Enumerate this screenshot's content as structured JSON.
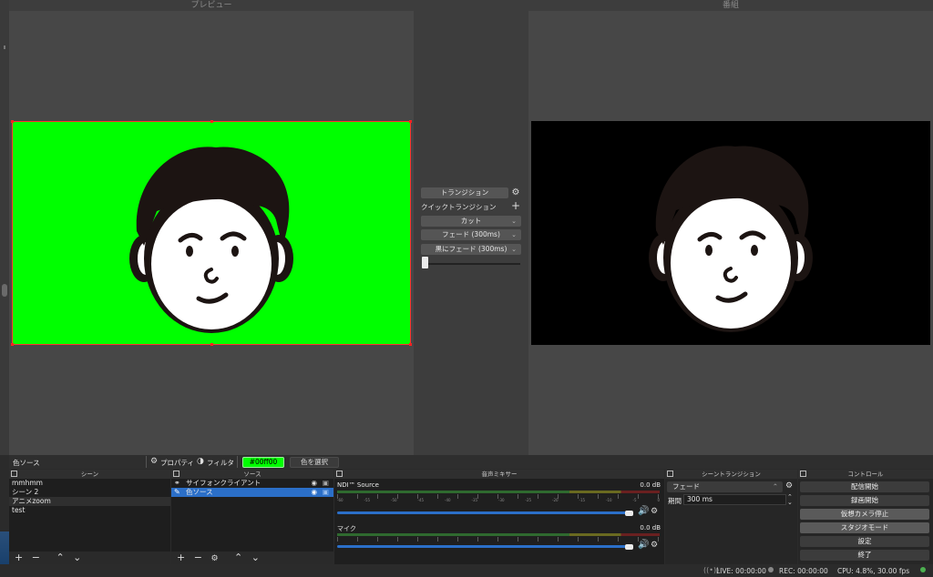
{
  "preview": {
    "title": "プレビュー"
  },
  "program": {
    "title": "番組"
  },
  "transitions_panel": {
    "transition_button": "トランジション",
    "quick_label": "クイックトランジション",
    "quick_items": [
      "カット",
      "フェード (300ms)",
      "黒にフェード (300ms)"
    ]
  },
  "source_toolbar": {
    "selected_source": "色ソース",
    "properties_label": "プロパティ",
    "filters_label": "フィルタ",
    "color_value": "#00ff00",
    "select_color_label": "色を選択"
  },
  "scenes": {
    "title": "シーン",
    "items": [
      "mmhmm",
      "シーン 2",
      "アニメzoom",
      "test"
    ],
    "selected_index": 2
  },
  "sources": {
    "title": "ソース",
    "items": [
      "サイフォンクライアント",
      "色ソース"
    ],
    "selected_index": 1
  },
  "mixer": {
    "title": "音声ミキサー",
    "channels": [
      {
        "name": "NDI™ Source",
        "db": "0.0 dB"
      },
      {
        "name": "マイク",
        "db": "0.0 dB"
      }
    ],
    "tick_labels": [
      "-60",
      "-55",
      "-50",
      "-45",
      "-40",
      "-35",
      "-30",
      "-25",
      "-20",
      "-15",
      "-10",
      "-5",
      "0"
    ]
  },
  "scene_transitions": {
    "title": "シーントランジション",
    "selected": "フェード",
    "duration_label": "期間",
    "duration_value": "300 ms"
  },
  "controls": {
    "title": "コントロール",
    "buttons": [
      "配信開始",
      "録画開始",
      "仮想カメラ停止",
      "スタジオモード",
      "設定",
      "終了"
    ]
  },
  "status": {
    "live": "LIVE: 00:00:00",
    "rec": "REC: 00:00:00",
    "cpu": "CPU: 4.8%, 30.00 fps"
  },
  "colors": {
    "accent": "#2b6fc8",
    "chroma": "#00ff00"
  }
}
